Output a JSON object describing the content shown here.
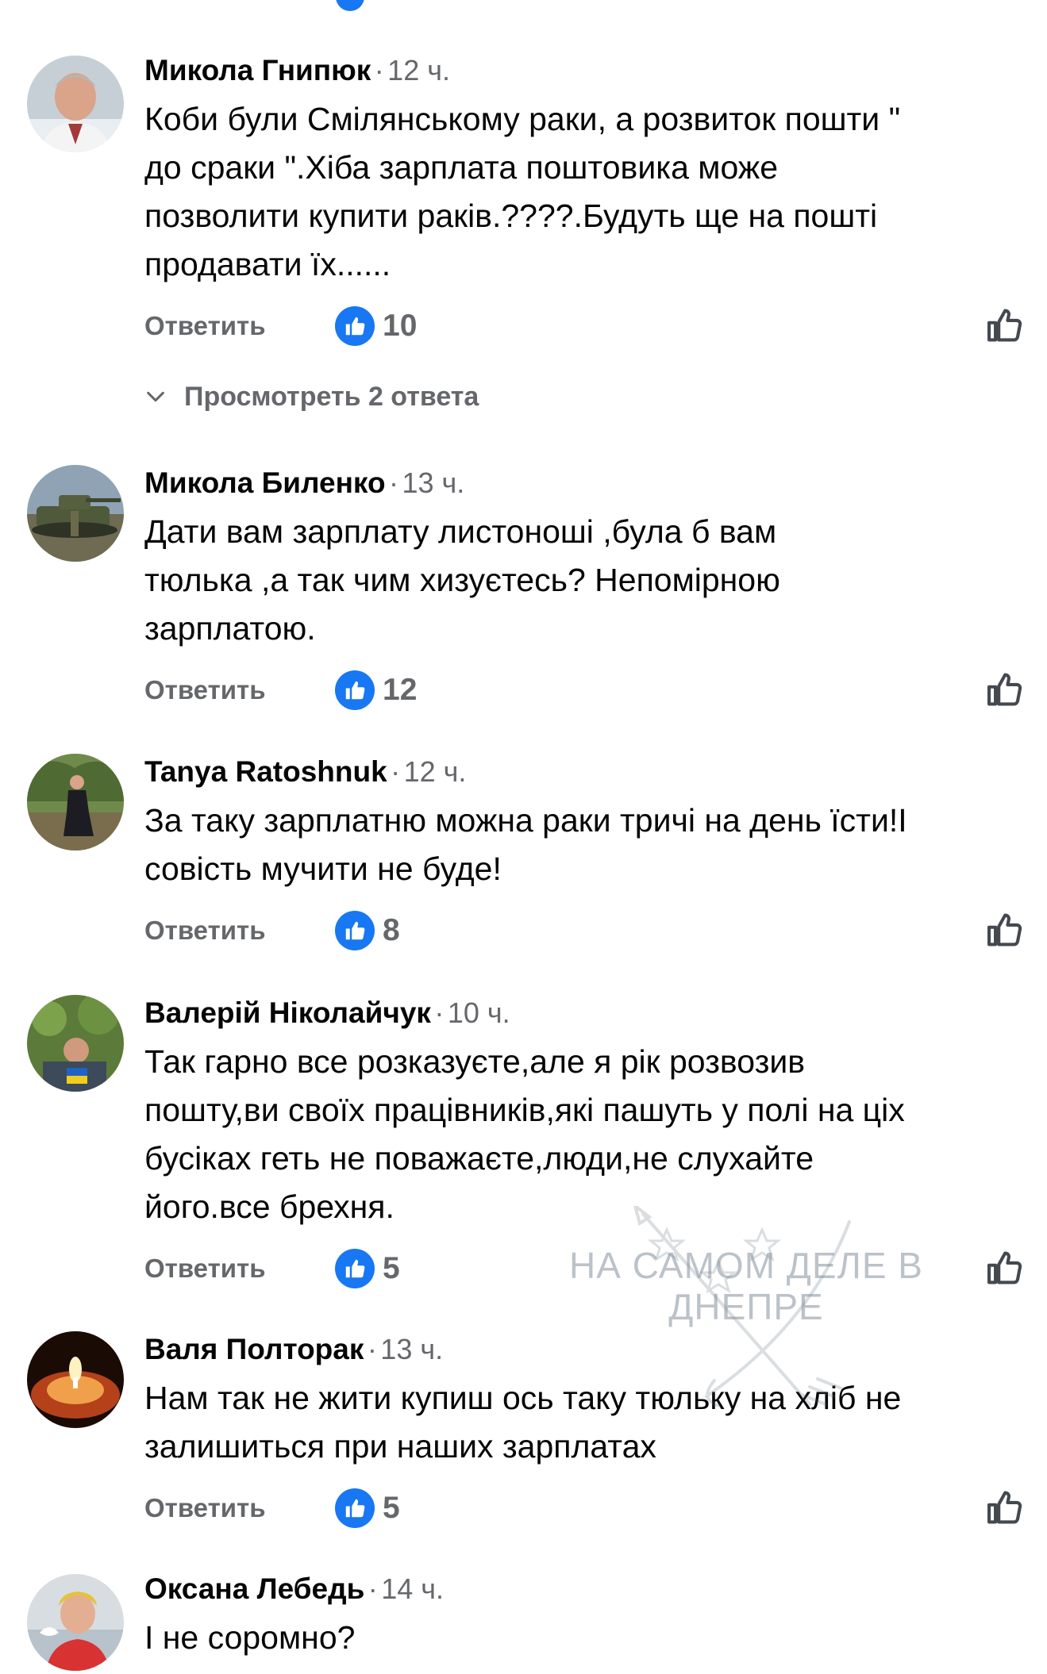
{
  "replies_toggle": "Просмотреть 2 ответа",
  "reply_label": "Ответить",
  "time_separator": "·",
  "watermark": {
    "line1": "НА САМОМ ДЕЛЕ В",
    "line2": "ДНЕПРЕ"
  },
  "icons": {
    "reaction": "like-reaction-icon",
    "like_button": "thumbs-up-outline-icon",
    "toggle": "chevron-down-icon"
  },
  "colors": {
    "accent": "#1877f2",
    "muted": "#65676b",
    "text": "#050505"
  },
  "comments": [
    {
      "author": "Микола Гнипюк",
      "time": "12 ч.",
      "text": [
        "Коби були Смілянському раки, а розвиток пошти \"",
        "до сраки \".Хіба зарплата поштовика може",
        "позволити купити  раків.????.Будуть ще на пошті",
        "продавати їх......"
      ],
      "likes": "10"
    },
    {
      "author": "Микола Биленко",
      "time": "13 ч.",
      "text": [
        "Дати вам зарплату листоноші ,була б вам",
        "тюлька ,а так чим хизуєтесь? Непомірною",
        "зарплатою."
      ],
      "likes": "12"
    },
    {
      "author": "Tanya Ratoshnuk",
      "time": "12 ч.",
      "text": [
        "За таку зарплатню можна раки тричі на день їсти!І",
        "совість мучити не буде!"
      ],
      "likes": "8"
    },
    {
      "author": "Валерій Ніколайчук",
      "time": "10 ч.",
      "text": [
        "Так гарно все розказуєте,але я рік розвозив",
        "пошту,ви своїх працівників,які пашуть у полі на ціх",
        "бусіках геть не поважаєте,люди,не слухайте",
        "його.все брехня."
      ],
      "likes": "5"
    },
    {
      "author": "Валя Полторак",
      "time": "13 ч.",
      "text": [
        "Нам так не жити купиш ось таку тюльку на хліб не",
        "залишиться при наших зарплатах"
      ],
      "likes": "5"
    },
    {
      "author": "Оксана Лебедь",
      "time": "14 ч.",
      "text": [
        "І не соромно?"
      ]
    }
  ]
}
